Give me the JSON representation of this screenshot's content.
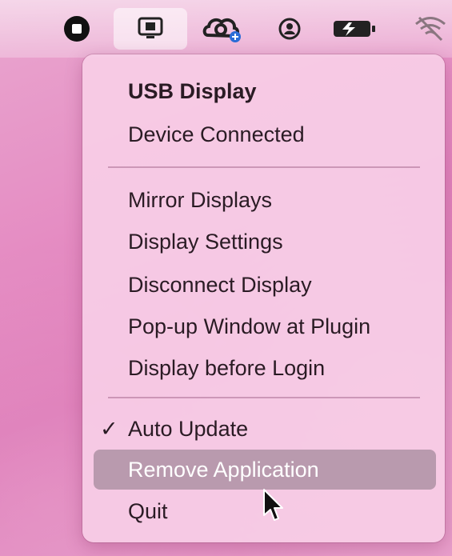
{
  "menubar": {
    "icons": [
      "stop-icon",
      "usb-display-icon",
      "creative-cloud-icon",
      "user-icon",
      "battery-icon",
      "wifi-off-icon"
    ]
  },
  "menu": {
    "title": "USB Display",
    "status": "Device Connected",
    "items": [
      {
        "label": "Mirror Displays"
      },
      {
        "label": "Display Settings"
      },
      {
        "label": "Disconnect Display"
      },
      {
        "label": "Pop-up Window at Plugin"
      },
      {
        "label": "Display before Login"
      }
    ],
    "auto_update": {
      "label": "Auto Update",
      "checked": true,
      "check_glyph": "✓"
    },
    "remove_application": {
      "label": "Remove Application"
    },
    "quit": {
      "label": "Quit"
    }
  },
  "colors": {
    "highlight": "#b99aae",
    "menu_background": "#f8cee6",
    "text": "#2a1b24"
  }
}
